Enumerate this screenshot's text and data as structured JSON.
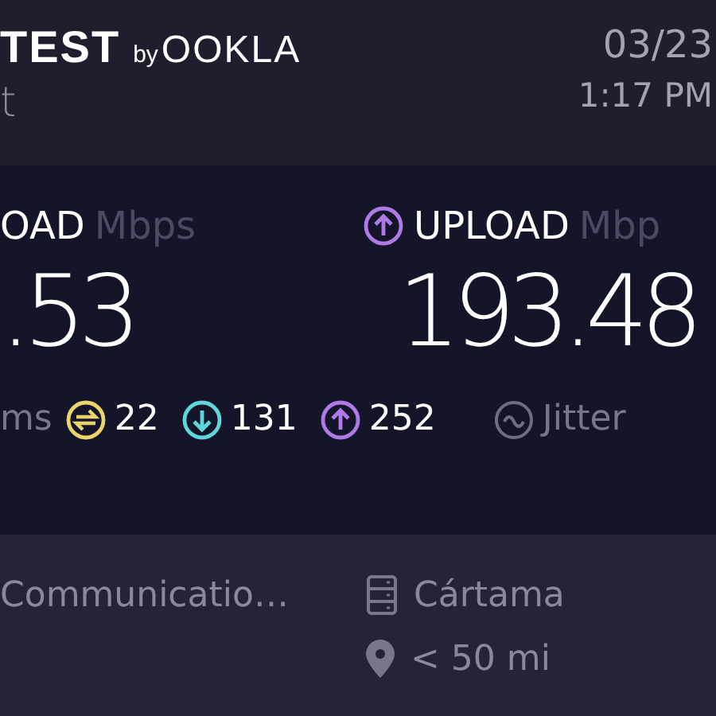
{
  "header": {
    "logo": "TEST",
    "logo_by": "by",
    "logo_brand": "OOKLA",
    "subtitle": "t",
    "date": "03/23",
    "time": "1:17 PM"
  },
  "speeds": [
    {
      "kind": "download",
      "label": "OAD",
      "unit": "Mbps",
      "value": ".53"
    },
    {
      "kind": "upload",
      "label": "UPLOAD",
      "unit": "Mbp",
      "value": "193.48"
    }
  ],
  "ping": {
    "unit": "ms",
    "items": [
      {
        "kind": "idle",
        "value": "22",
        "color": "#e9d56c"
      },
      {
        "kind": "download",
        "value": "131",
        "color": "#5fd6dc"
      },
      {
        "kind": "upload",
        "value": "252",
        "color": "#b07ae6"
      }
    ]
  },
  "jitter": "Jitter",
  "provider": "Communicatio…",
  "server": {
    "name": "Cártama",
    "distance": "< 50 mi"
  }
}
